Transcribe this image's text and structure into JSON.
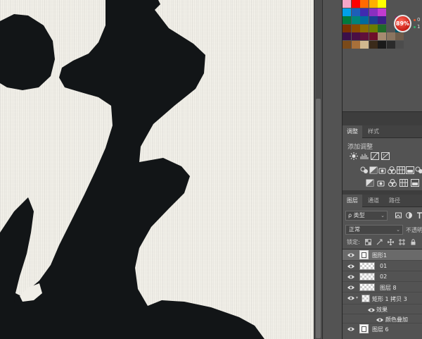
{
  "badge": {
    "percent": "89%",
    "stat_top": "0",
    "stat_bottom": "1",
    "colors": {
      "ring": "#e9e9e9",
      "fill": "#d22a1e",
      "dot_up": "#e8542b",
      "dot_down": "#2fb36b"
    }
  },
  "swatch_colors": [
    [
      "#f6a6c8",
      "#ff0000",
      "#ff6a00",
      "#ffb000",
      "#ffff00",
      "#9fd400",
      "#2ed000"
    ],
    [
      "#00a0e9",
      "#1d5fb8",
      "#3f2bb0",
      "#8a2fc0",
      "#c23bd0",
      "#e84a99",
      "#ffffff"
    ],
    [
      "#007a3d",
      "#00847a",
      "#006b9d",
      "#1c3e91",
      "#3a1f85",
      "#6b2182",
      "#8f1f5f"
    ],
    [
      "#7a3100",
      "#8a4a00",
      "#8a6b00",
      "#6b7d00",
      "#1f6b2a",
      "#00604b",
      "#00566b"
    ],
    [
      "#3b0f49",
      "#4a0f45",
      "#60103a",
      "#6e0f2a",
      "#a68b70",
      "#8a7560",
      "#6d5c4b"
    ],
    [
      "#7a4a1a",
      "#a8703a",
      "#d0b890",
      "#3a2a1a",
      "#1a1a1a",
      "#2b2b2b",
      "#4c4c4c"
    ]
  ],
  "adjustments": {
    "tabs": [
      "调整",
      "样式"
    ],
    "title": "添加调整",
    "icons": [
      [
        "brightness-contrast-icon",
        "levels-icon",
        "curves-icon",
        "exposure-icon"
      ],
      [
        "vibrance-icon",
        "hue-saturation-icon",
        "color-balance-icon",
        "black-white-icon",
        "photo-filter-icon",
        "channel-mixer-icon",
        "color-lookup-icon"
      ],
      [
        "invert-icon",
        "posterize-icon",
        "threshold-icon",
        "gradient-map-icon",
        "selective-color-icon"
      ]
    ]
  },
  "layers": {
    "tabs": [
      "图层",
      "通道",
      "路径"
    ],
    "filter_label": "ρ 类型",
    "blend_mode": "正常",
    "opacity_label": "不透明",
    "lock_label": "锁定:",
    "items": [
      {
        "name": "图形1",
        "kind": "smart",
        "selected": true
      },
      {
        "name": "01",
        "kind": "pattern"
      },
      {
        "name": "02",
        "kind": "pattern"
      },
      {
        "name": "图层 8",
        "kind": "pattern"
      },
      {
        "name": "矩形 1 拷贝 3",
        "kind": "group"
      },
      {
        "name": "效果",
        "kind": "effects"
      },
      {
        "name": "颜色叠加",
        "kind": "effect"
      },
      {
        "name": "图层 6",
        "kind": "smart"
      }
    ]
  }
}
